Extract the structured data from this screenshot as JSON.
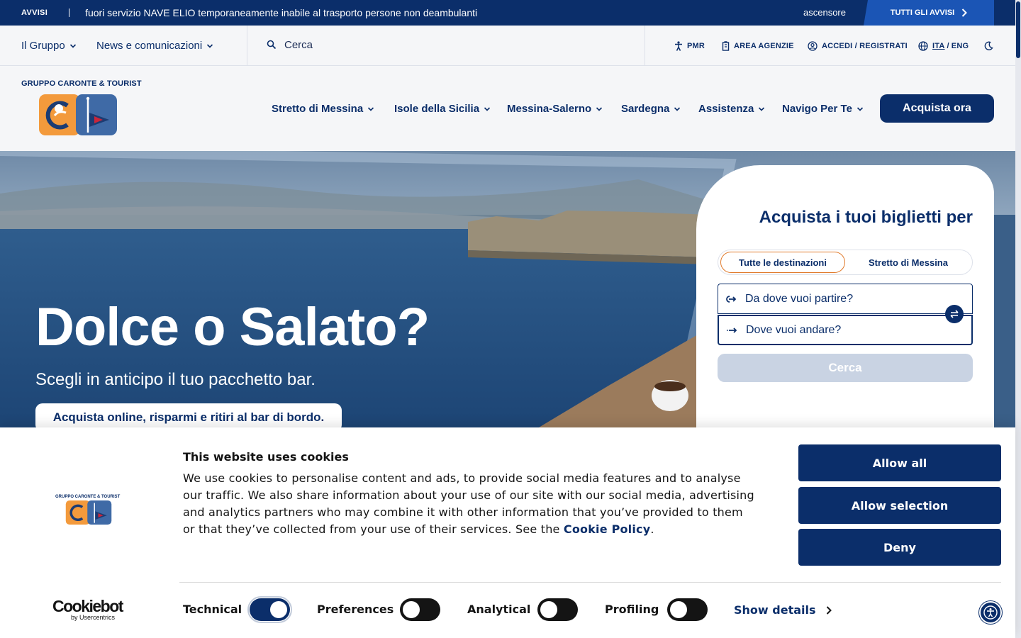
{
  "alert_bar": {
    "label": "AVVISI",
    "message": "fuori servizio NAVE ELIO temporaneamente inabile al trasporto persone non deambulanti",
    "side_text": "ascensore",
    "all_alerts_label": "TUTTI GLI AVVISI"
  },
  "utility_bar": {
    "menu": [
      {
        "label": "Il Gruppo"
      },
      {
        "label": "News e comunicazioni"
      }
    ],
    "search_placeholder": "Cerca",
    "links": {
      "pmr": "PMR",
      "agencies": "AREA AGENZIE",
      "login": "ACCEDI / REGISTRATI",
      "lang_ita": "ITA",
      "lang_sep": "/",
      "lang_eng": "ENG"
    }
  },
  "header": {
    "brand": "GRUPPO CARONTE & TOURIST",
    "nav": [
      {
        "label": "Stretto di Messina"
      },
      {
        "label": "Isole della Sicilia"
      },
      {
        "label": "Messina-Salerno"
      },
      {
        "label": "Sardegna"
      },
      {
        "label": "Assistenza"
      },
      {
        "label": "Navigo Per Te"
      }
    ],
    "buy_button": "Acquista ora"
  },
  "hero": {
    "title": "Dolce o Salato?",
    "subtitle": "Scegli in anticipo il tuo pacchetto bar.",
    "cta": "Acquista online, risparmi e ritiri al bar di bordo."
  },
  "booking": {
    "title": "Acquista i tuoi biglietti per",
    "tabs": [
      "Tutte le destinazioni",
      "Stretto di Messina"
    ],
    "from_placeholder": "Da dove vuoi partire?",
    "to_placeholder": "Dove vuoi andare?",
    "search_button": "Cerca"
  },
  "cookie_banner": {
    "logo_brand": "GRUPPO CARONTE & TOURIST",
    "title": "This website uses cookies",
    "body": "We use cookies to personalise content and ads, to provide social media features and to analyse our traffic. We also share information about your use of our site with our social media, advertising and analytics partners who may combine it with other information that you’ve provided to them or that they’ve collected from your use of their services. See the ",
    "policy_link": "Cookie Policy",
    "body_end": ".",
    "buttons": {
      "allow_all": "Allow all",
      "allow_selection": "Allow selection",
      "deny": "Deny"
    },
    "provider_name": "Cookiebot",
    "provider_by": "by Usercentrics",
    "toggles": [
      {
        "label": "Technical",
        "on": true
      },
      {
        "label": "Preferences",
        "on": false
      },
      {
        "label": "Analytical",
        "on": false
      },
      {
        "label": "Profiling",
        "on": false
      }
    ],
    "show_details": "Show details"
  },
  "colors": {
    "brand_navy": "#0b2e6a",
    "accent_blue": "#1b55b5",
    "accent_orange": "#e07a2b"
  }
}
